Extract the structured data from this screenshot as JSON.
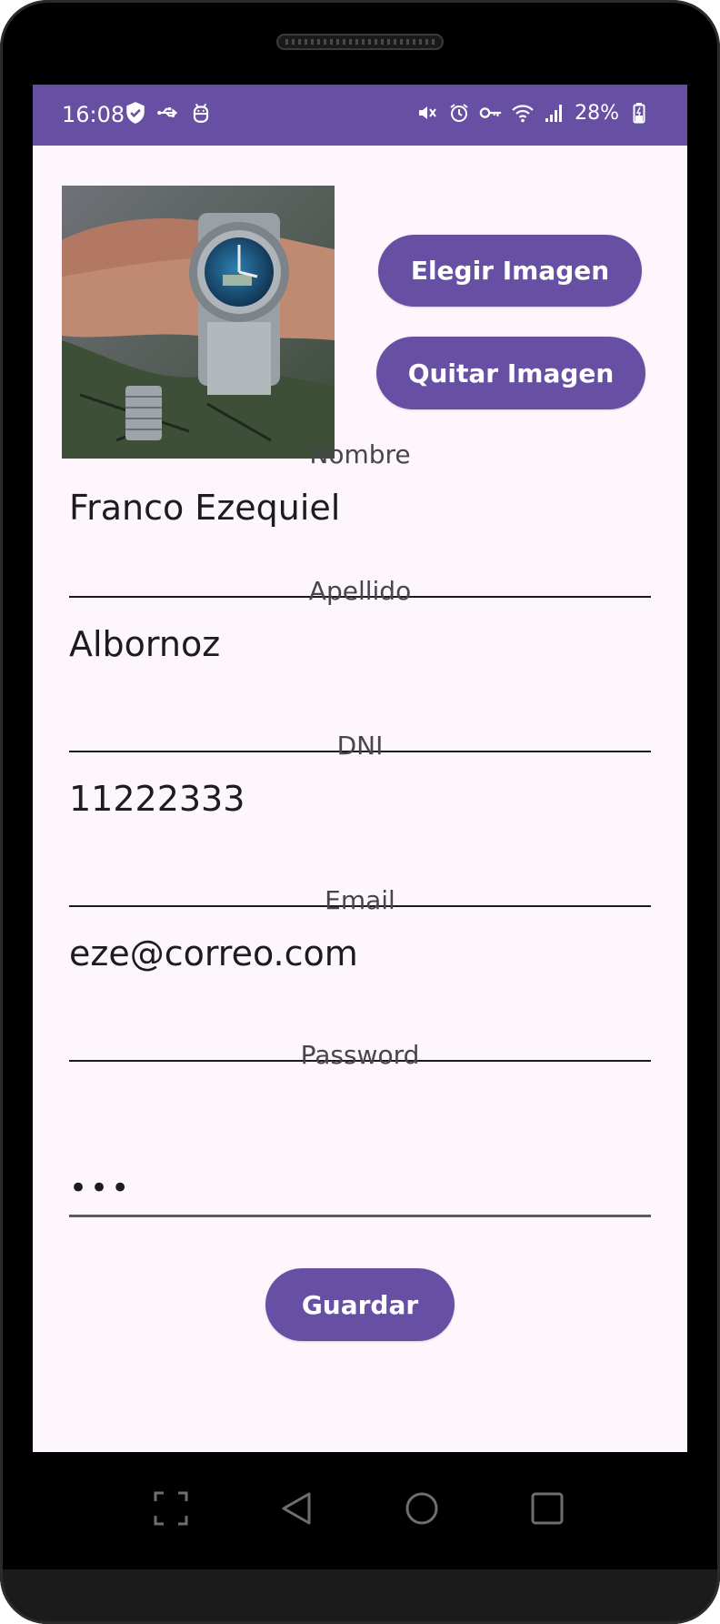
{
  "status_bar": {
    "time": "16:08",
    "battery_percent": "28%",
    "icons_left": [
      "shield-check-icon",
      "usb-icon",
      "android-debug-icon"
    ],
    "icons_right": [
      "mute-vibrate-icon",
      "alarm-icon",
      "vpn-key-icon",
      "wifi-icon",
      "signal-icon",
      "battery-charging-icon"
    ]
  },
  "profile": {
    "photo_alt": "wristwatch photo",
    "choose_image_label": "Elegir Imagen",
    "remove_image_label": "Quitar Imagen"
  },
  "form": {
    "nombre": {
      "label": "Nombre",
      "value": "Franco Ezequiel"
    },
    "apellido": {
      "label": "Apellido",
      "value": "Albornoz"
    },
    "dni": {
      "label": "DNI",
      "value": "11222333"
    },
    "email": {
      "label": "Email",
      "value": "eze@correo.com"
    },
    "password": {
      "label": "Password",
      "masked_value": "•••"
    },
    "save_label": "Guardar"
  },
  "nav_bar": {
    "buttons": [
      "screenshot-icon",
      "back-icon",
      "home-icon",
      "recents-icon"
    ]
  },
  "colors": {
    "primary": "#6750a4",
    "background": "#fdf7fd",
    "text": "#1c1b1f",
    "label": "#49454f"
  }
}
